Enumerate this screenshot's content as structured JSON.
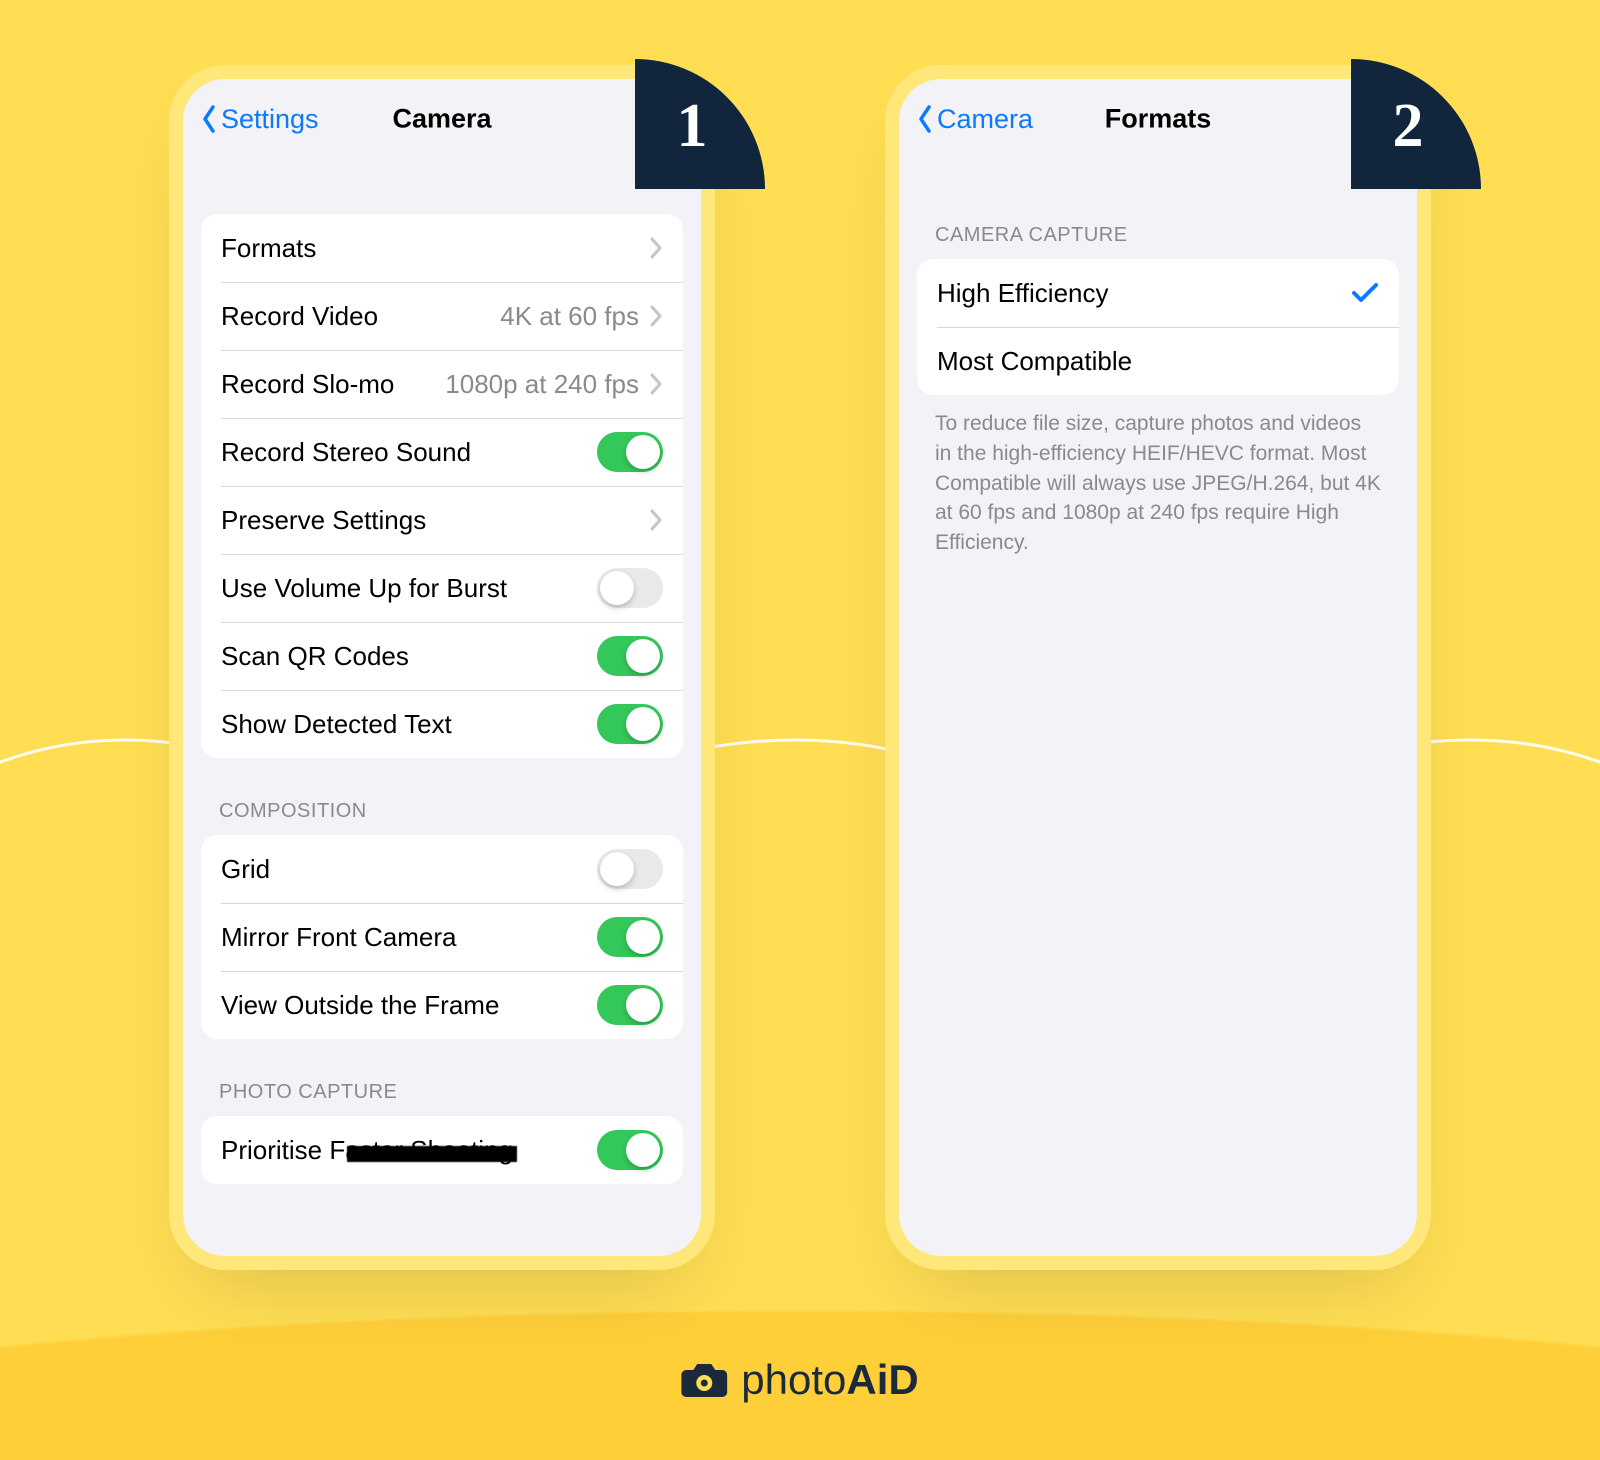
{
  "badges": {
    "phone1": "1",
    "phone2": "2"
  },
  "phone1": {
    "back_label": "Settings",
    "title": "Camera",
    "group1": [
      {
        "name": "row-formats",
        "label": "Formats",
        "type": "disclosure"
      },
      {
        "name": "row-record-video",
        "label": "Record Video",
        "type": "disclosure",
        "detail": "4K at 60 fps"
      },
      {
        "name": "row-record-slomo",
        "label": "Record Slo-mo",
        "type": "disclosure",
        "detail": "1080p at 240 fps"
      },
      {
        "name": "row-record-stereo-sound",
        "label": "Record Stereo Sound",
        "type": "toggle",
        "on": true
      },
      {
        "name": "row-preserve-settings",
        "label": "Preserve Settings",
        "type": "disclosure"
      },
      {
        "name": "row-volume-up-burst",
        "label": "Use Volume Up for Burst",
        "type": "toggle",
        "on": false
      },
      {
        "name": "row-scan-qr",
        "label": "Scan QR Codes",
        "type": "toggle",
        "on": true
      },
      {
        "name": "row-show-detected-text",
        "label": "Show Detected Text",
        "type": "toggle",
        "on": true
      }
    ],
    "composition_header": "COMPOSITION",
    "group2": [
      {
        "name": "row-grid",
        "label": "Grid",
        "type": "toggle",
        "on": false
      },
      {
        "name": "row-mirror-front",
        "label": "Mirror Front Camera",
        "type": "toggle",
        "on": true
      },
      {
        "name": "row-view-outside-frame",
        "label": "View Outside the Frame",
        "type": "toggle",
        "on": true
      }
    ],
    "photo_capture_header": "PHOTO CAPTURE",
    "group3": [
      {
        "name": "row-prioritise-faster-shooting",
        "label_parts": [
          "Prioritise F",
          "aster Shooting"
        ],
        "scratch": true,
        "type": "toggle",
        "on": true
      }
    ]
  },
  "phone2": {
    "back_label": "Camera",
    "title": "Formats",
    "camera_capture_header": "CAMERA CAPTURE",
    "rows": [
      {
        "name": "row-high-efficiency",
        "label": "High Efficiency",
        "type": "check",
        "checked": true
      },
      {
        "name": "row-most-compatible",
        "label": "Most Compatible",
        "type": "check",
        "checked": false
      }
    ],
    "footer": "To reduce file size, capture photos and videos in the high-efficiency HEIF/HEVC format. Most Compatible will always use JPEG/H.264, but 4K at 60 fps and 1080p at 240 fps require High Efficiency."
  },
  "brand": {
    "pre": "photo",
    "post": "AiD"
  }
}
